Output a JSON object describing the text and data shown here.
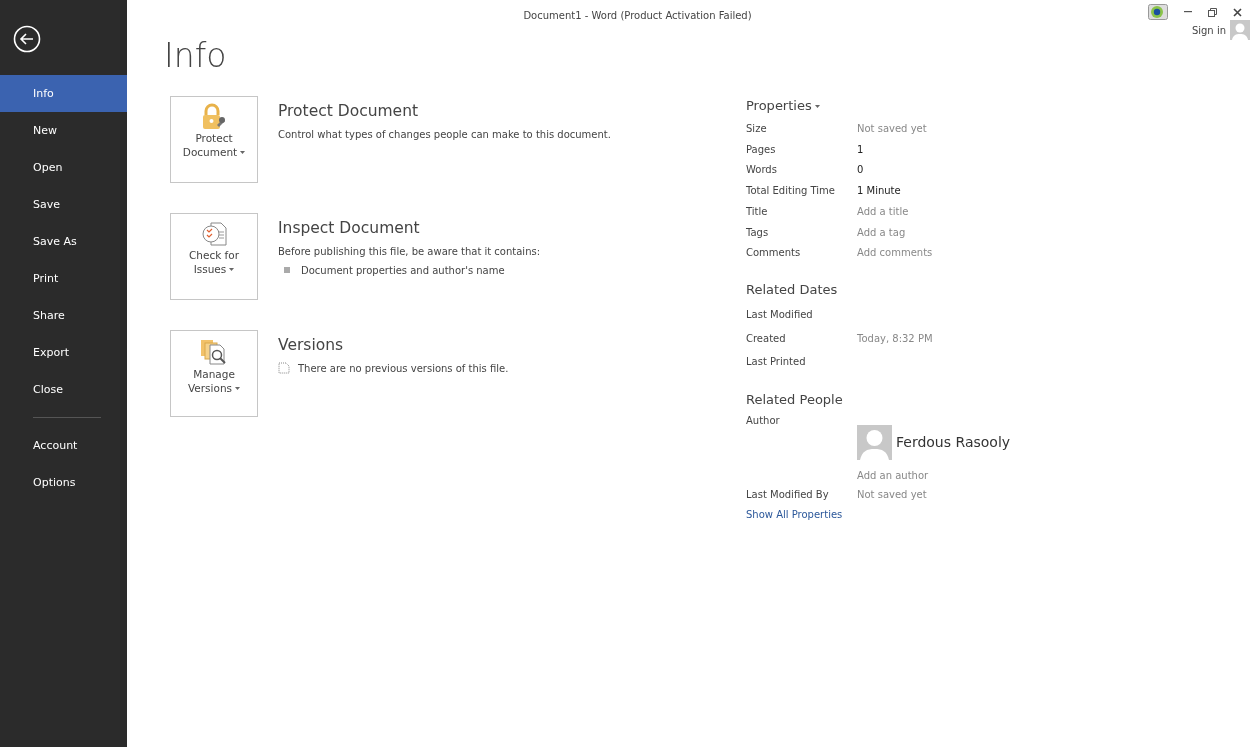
{
  "window": {
    "title": "Document1 - Word (Product Activation Failed)",
    "sign_in": "Sign in"
  },
  "sidebar": {
    "groups": [
      [
        {
          "label": "Info",
          "selected": true
        },
        {
          "label": "New",
          "selected": false
        },
        {
          "label": "Open",
          "selected": false
        },
        {
          "label": "Save",
          "selected": false
        },
        {
          "label": "Save As",
          "selected": false
        },
        {
          "label": "Print",
          "selected": false
        },
        {
          "label": "Share",
          "selected": false
        },
        {
          "label": "Export",
          "selected": false
        },
        {
          "label": "Close",
          "selected": false
        }
      ],
      [
        {
          "label": "Account",
          "selected": false
        },
        {
          "label": "Options",
          "selected": false
        }
      ]
    ]
  },
  "page_title": "Info",
  "sections": [
    {
      "kind": "protect",
      "button": [
        "Protect",
        "Document"
      ],
      "heading": "Protect Document",
      "text": "Control what types of changes people can make to this document."
    },
    {
      "kind": "inspect",
      "button": [
        "Check for",
        "Issues"
      ],
      "heading": "Inspect Document",
      "text": "Before publishing this file, be aware that it contains:",
      "bullets": [
        "Document properties and author's name"
      ]
    },
    {
      "kind": "versions",
      "button": [
        "Manage",
        "Versions"
      ],
      "heading": "Versions",
      "note": "There are no previous versions of this file."
    }
  ],
  "properties": {
    "heading": "Properties",
    "rows": [
      {
        "label": "Size",
        "value": "Not saved yet",
        "dimmed": true
      },
      {
        "label": "Pages",
        "value": "1",
        "dimmed": false
      },
      {
        "label": "Words",
        "value": "0",
        "dimmed": false
      },
      {
        "label": "Total Editing Time",
        "value": "1 Minute",
        "dimmed": false
      },
      {
        "label": "Title",
        "value": "Add a title",
        "dimmed": true
      },
      {
        "label": "Tags",
        "value": "Add a tag",
        "dimmed": true
      },
      {
        "label": "Comments",
        "value": "Add comments",
        "dimmed": true
      }
    ]
  },
  "related_dates": {
    "heading": "Related Dates",
    "rows": [
      {
        "label": "Last Modified"
      },
      {
        "label": "Created",
        "value": "Today, 8:32 PM"
      },
      {
        "label": "Last Printed"
      }
    ]
  },
  "related_people": {
    "heading": "Related People",
    "author_label": "Author",
    "author_name": "Ferdous Rasooly",
    "add_author": "Add an author",
    "last_modified_by_label": "Last Modified By",
    "last_modified_by": "Not saved yet"
  },
  "show_all_link": "Show All Properties"
}
